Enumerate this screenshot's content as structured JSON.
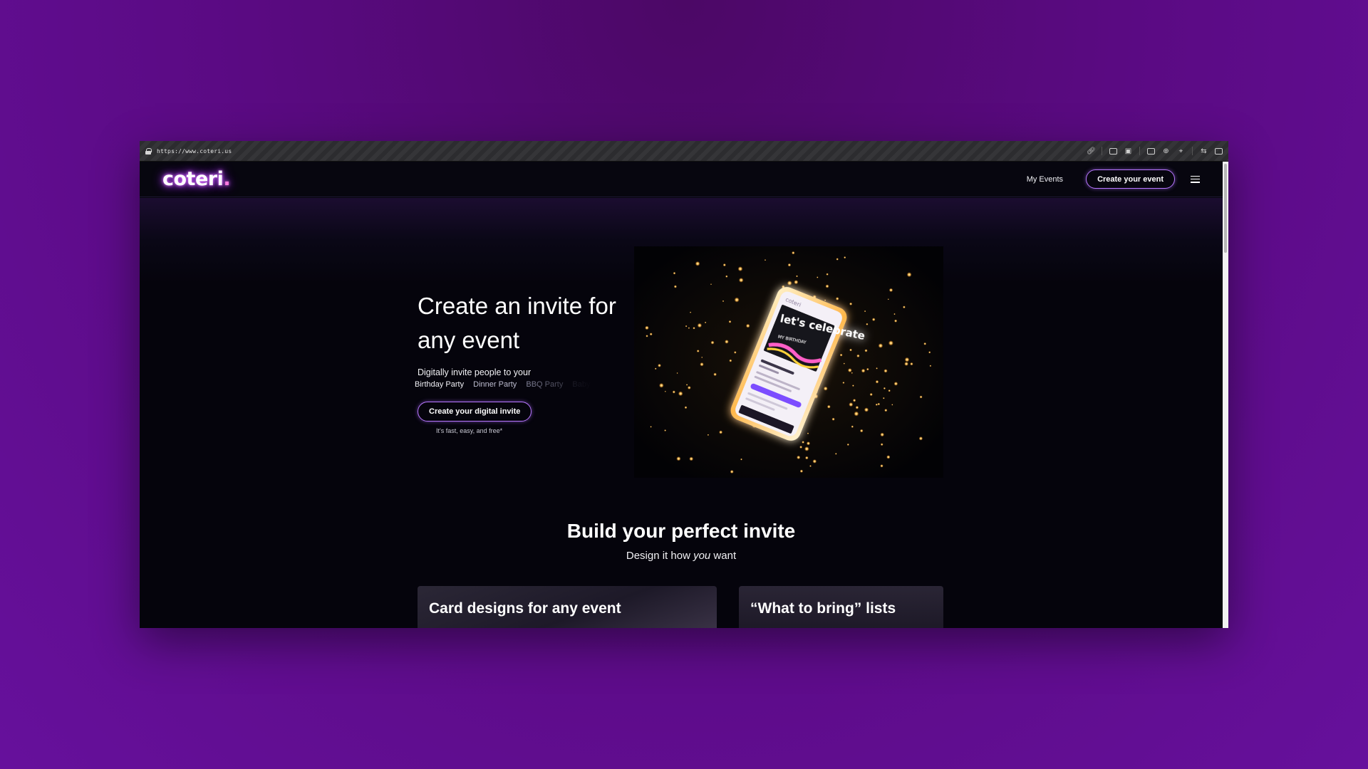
{
  "browser": {
    "url": "https://www.coteri.us"
  },
  "nav": {
    "logo_text": "coteri",
    "logo_dot": ".",
    "my_events": "My Events",
    "create_event": "Create your event"
  },
  "hero": {
    "title": "Create an invite for any event",
    "subtitle": "Digitally invite people to your",
    "event_types": [
      "Birthday Party",
      "Dinner Party",
      "BBQ Party",
      "Baby Shower"
    ],
    "cta": "Create your digital invite",
    "cta_note": "It's fast, easy, and free*",
    "phone_screen": {
      "brand": "coteri",
      "headline": "let's celebrate",
      "tagline": "MY BIRTHDAY"
    }
  },
  "features": {
    "title": "Build your perfect invite",
    "subtitle_pre": "Design it how ",
    "subtitle_em": "you",
    "subtitle_post": " want",
    "cards": [
      {
        "title": "Card designs for any event"
      },
      {
        "title": "“What to bring” lists"
      }
    ]
  },
  "colors": {
    "background": "#5a0a82",
    "page": "#05040c",
    "accent": "#b877ff",
    "logo_glow": "#b341ff"
  }
}
